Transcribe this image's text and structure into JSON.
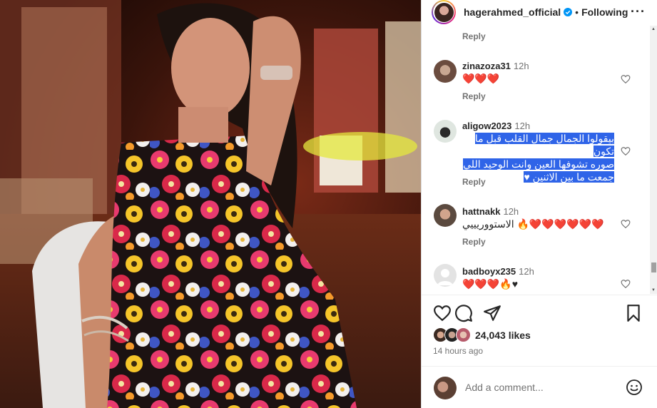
{
  "post": {
    "username": "hagerahmed_official",
    "separator": "•",
    "follow_state": "Following",
    "more_label": "···"
  },
  "comments": [
    {
      "reply_label": "Reply"
    },
    {
      "user": "zinazoza31",
      "time": "12h",
      "text": "❤️❤️❤️",
      "reply_label": "Reply"
    },
    {
      "user": "aligow2023",
      "time": "12h",
      "lines": [
        "بيقولوا الجمال جمال القلب قبل ما تكون",
        "صوره تشوفها العين وانت الوحيد اللي",
        "جمعت ما بين الاثنين ♥"
      ],
      "reply_label": "Reply"
    },
    {
      "user": "hattnakk",
      "time": "12h",
      "text": "الاستووريييي 🔥❤️❤️❤️❤️❤️❤️",
      "reply_label": "Reply"
    },
    {
      "user": "badboyx235",
      "time": "12h",
      "text": "❤️❤️❤️🔥♥"
    }
  ],
  "likes": {
    "count": "24,043 likes"
  },
  "time_ago": "14 hours ago",
  "add_comment": {
    "placeholder": "Add a comment..."
  },
  "colors": {
    "accent": "#0095f6",
    "highlight": "#2f64e8",
    "heart": "#ed2f3d"
  }
}
